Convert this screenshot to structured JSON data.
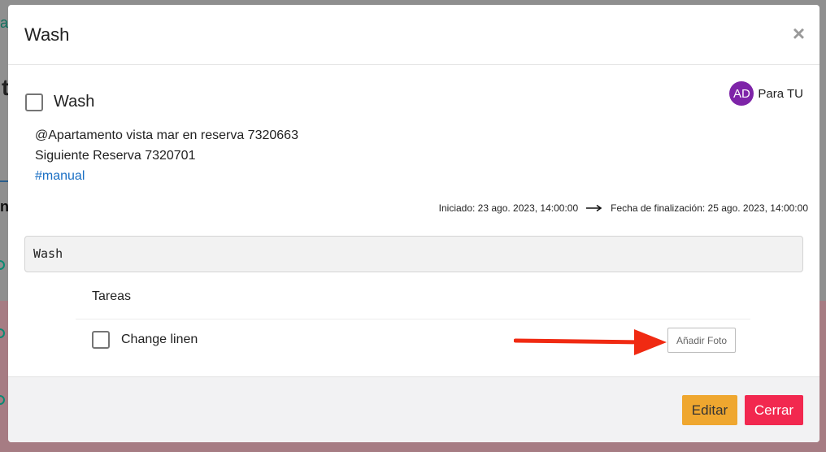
{
  "background": {
    "teal_text": "a",
    "big_text": "t",
    "dark_text": "n"
  },
  "modal": {
    "title": "Wash",
    "close_symbol": "×",
    "task": {
      "title": "Wash",
      "checked": false
    },
    "assignee": {
      "initials": "AD",
      "name": "Para TU",
      "avatar_color": "#7e24a8"
    },
    "description": {
      "line1": "@Apartamento vista mar en reserva 7320663",
      "line2": "Siguiente Reserva 7320701",
      "tag": "#manual"
    },
    "dates": {
      "started": "Iniciado: 23 ago. 2023, 14:00:00",
      "ended": "Fecha de finalización: 25 ago. 2023, 14:00:00"
    },
    "name_field_value": "Wash",
    "tasks_section": {
      "heading": "Tareas",
      "items": [
        {
          "label": "Change linen",
          "checked": false,
          "photo_button": "Añadir Foto"
        }
      ]
    },
    "footer": {
      "edit_label": "Editar",
      "close_label": "Cerrar"
    }
  },
  "colors": {
    "edit_button": "#efa72f",
    "close_button": "#f2284f",
    "tag_link": "#1a6fc4",
    "annotation_arrow": "#f02a12"
  }
}
